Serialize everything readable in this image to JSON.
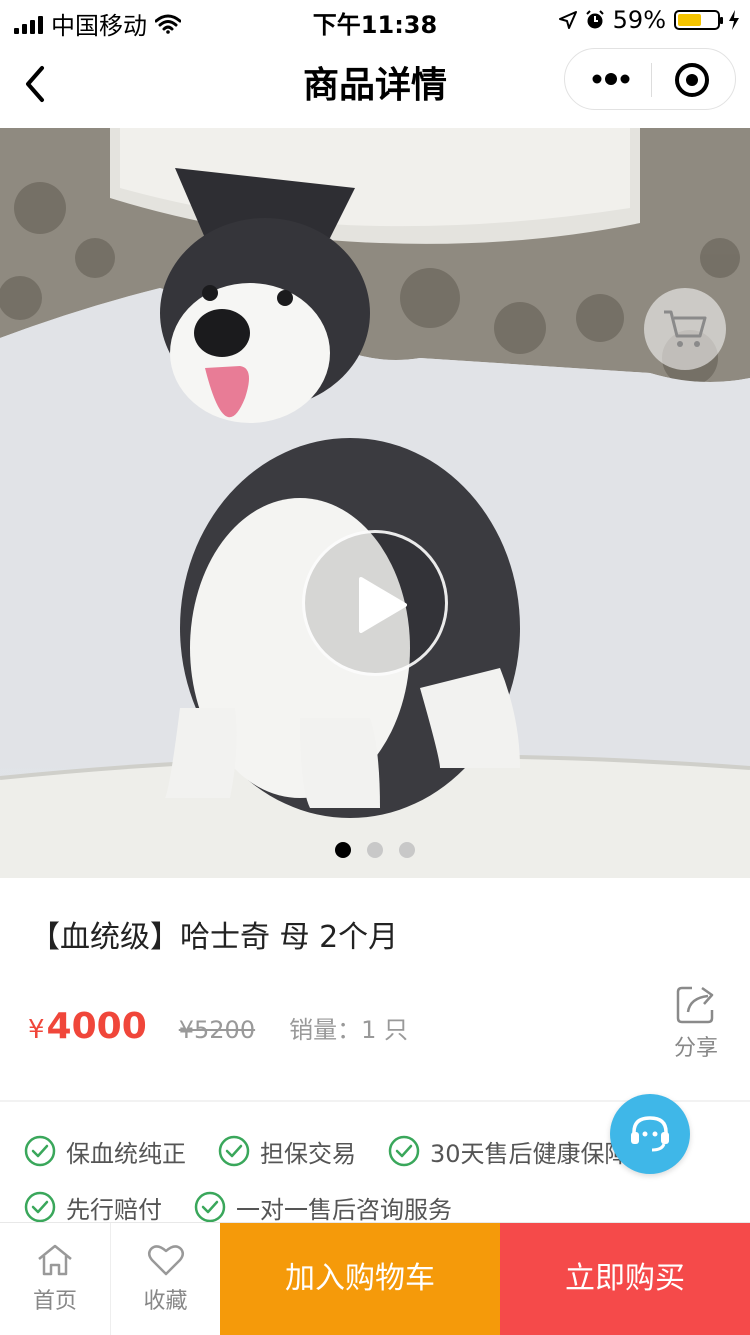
{
  "status_bar": {
    "carrier": "中国移动",
    "time": "下午11:38",
    "battery": "59%",
    "battery_level": 0.59
  },
  "nav": {
    "title": "商品详情"
  },
  "carousel": {
    "slide_count": 3,
    "active_index": 0
  },
  "product": {
    "title": "【血统级】哈士奇 母 2个月",
    "currency": "¥",
    "price": "4000",
    "original_price": "¥5200",
    "sales": "销量：1 只",
    "share_label": "分享"
  },
  "guarantees": [
    "保血统纯正",
    "担保交易",
    "30天售后健康保障",
    "先行赔付",
    "一对一售后咨询服务"
  ],
  "bottom_bar": {
    "home": "首页",
    "favorite": "收藏",
    "add_to_cart": "加入购物车",
    "buy_now": "立即购买"
  },
  "colors": {
    "price": "#f0463a",
    "check": "#3aa75b",
    "cart_button": "#f59a0a",
    "buy_button": "#f54a4a",
    "service_button": "#3fb7e8"
  }
}
